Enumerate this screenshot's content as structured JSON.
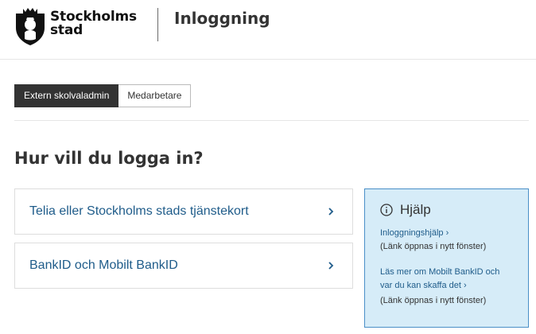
{
  "header": {
    "brand_line1": "Stockholms",
    "brand_line2": "stad",
    "page_title": "Inloggning"
  },
  "tabs": [
    {
      "label": "Extern skolvaladmin",
      "active": true
    },
    {
      "label": "Medarbetare",
      "active": false
    }
  ],
  "main": {
    "heading": "Hur vill du logga in?",
    "options": [
      {
        "label": "Telia eller Stockholms stads tjänstekort"
      },
      {
        "label": "BankID och Mobilt BankID"
      }
    ]
  },
  "help": {
    "title": "Hjälp",
    "link1": "Inloggningshjälp ›",
    "note1": "(Länk öppnas i nytt fönster)",
    "link2_line1": "Läs mer om Mobilt BankID och",
    "link2_line2": "var du kan skaffa det ›",
    "note2": "(Länk öppnas i nytt fönster)"
  },
  "colors": {
    "link": "#1f5c8a",
    "help_bg": "#d6ecf8",
    "help_border": "#4a8fc7",
    "tab_active_bg": "#333333"
  },
  "icons": {
    "logo": "stockholm-crest-icon",
    "option_arrow": "chevron-right-icon",
    "help": "info-circle-icon"
  }
}
